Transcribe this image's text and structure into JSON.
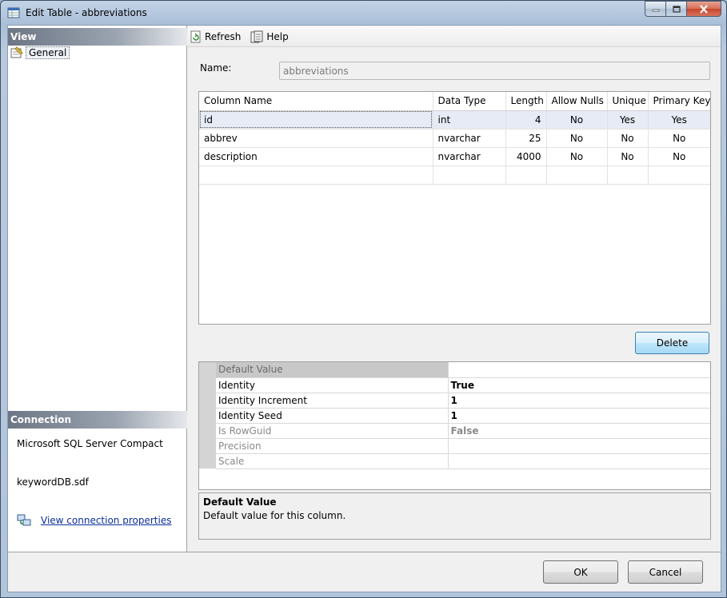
{
  "window": {
    "title": "Edit Table - abbreviations"
  },
  "sidebar": {
    "view_header": "View",
    "items": [
      {
        "label": "General",
        "icon": "general-page-icon"
      }
    ],
    "connection_header": "Connection",
    "server": "Microsoft SQL Server Compact",
    "file": "keywordDB.sdf",
    "view_connection_link": "View connection properties"
  },
  "toolbar": {
    "refresh_label": "Refresh",
    "help_label": "Help"
  },
  "form": {
    "name_label": "Name:",
    "name_value": "abbreviations"
  },
  "columns_grid": {
    "headers": [
      "Column Name",
      "Data Type",
      "Length",
      "Allow Nulls",
      "Unique",
      "Primary Key"
    ],
    "rows": [
      {
        "name": "id",
        "type": "int",
        "length": "4",
        "nulls": "No",
        "unique": "Yes",
        "pk": "Yes"
      },
      {
        "name": "abbrev",
        "type": "nvarchar",
        "length": "25",
        "nulls": "No",
        "unique": "No",
        "pk": "No"
      },
      {
        "name": "description",
        "type": "nvarchar",
        "length": "4000",
        "nulls": "No",
        "unique": "No",
        "pk": "No"
      }
    ]
  },
  "delete_label": "Delete",
  "properties": [
    {
      "name": "Default Value",
      "value": ""
    },
    {
      "name": "Identity",
      "value": "True"
    },
    {
      "name": "Identity Increment",
      "value": "1"
    },
    {
      "name": "Identity Seed",
      "value": "1"
    },
    {
      "name": "Is RowGuid",
      "value": "False"
    },
    {
      "name": "Precision",
      "value": ""
    },
    {
      "name": "Scale",
      "value": ""
    }
  ],
  "description_panel": {
    "title": "Default Value",
    "text": "Default value for this column."
  },
  "buttons": {
    "ok": "OK",
    "cancel": "Cancel"
  }
}
